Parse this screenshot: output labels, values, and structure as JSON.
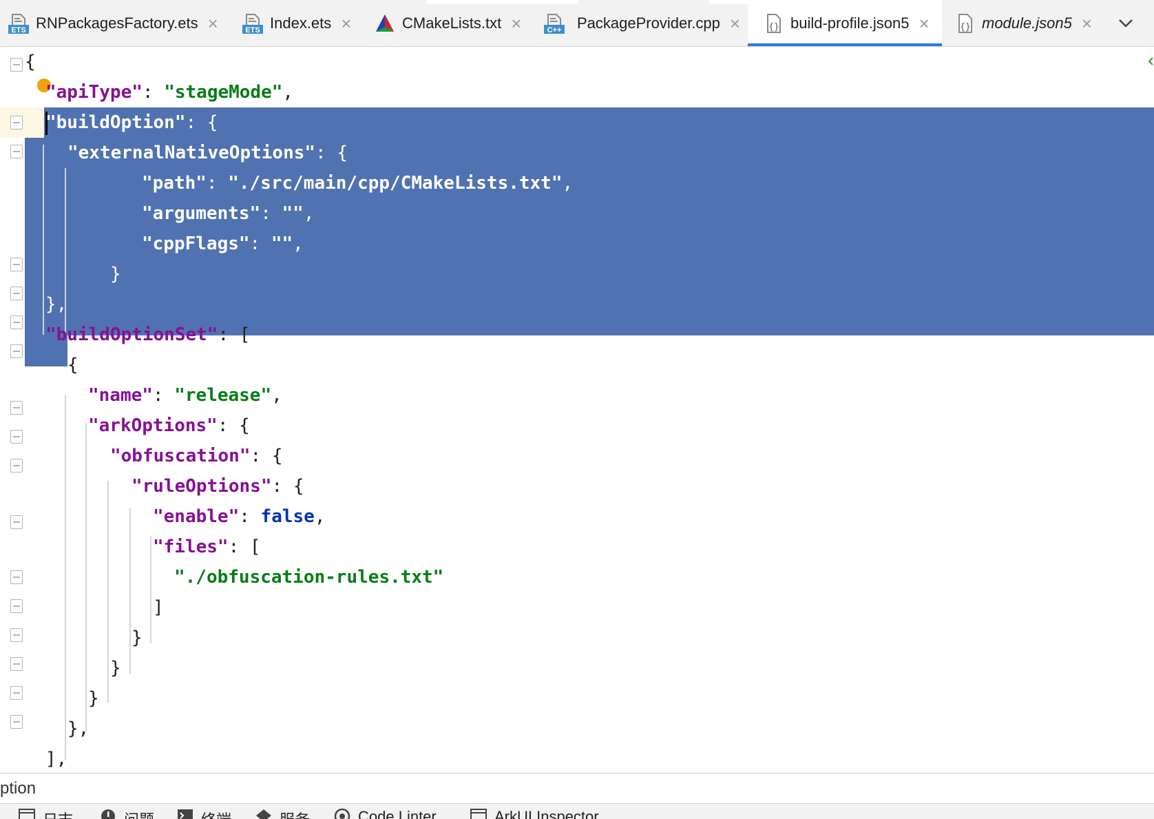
{
  "tabs": [
    {
      "label": "RNPackagesFactory.ets",
      "icon": "ets-file-icon",
      "icon_text": "ETS",
      "active": false
    },
    {
      "label": "Index.ets",
      "icon": "ets-file-icon",
      "icon_text": "ETS",
      "active": false
    },
    {
      "label": "CMakeLists.txt",
      "icon": "cmake-file-icon",
      "active": false
    },
    {
      "label": "PackageProvider.cpp",
      "icon": "cpp-file-icon",
      "icon_text": "C++",
      "active": false
    },
    {
      "label": "build-profile.json5",
      "icon": "json5-file-icon",
      "active": true
    },
    {
      "label": "module.json5",
      "icon": "json5-file-icon",
      "active": false,
      "italic": true
    }
  ],
  "colors": {
    "key": "#871094",
    "string": "#067d17",
    "boolean": "#0033b3",
    "selection": "#5072b0",
    "active_tab_underline": "#2d7bd8",
    "current_line": "#fcf6e4",
    "intention_bulb": "#f0a30a"
  },
  "editor": {
    "file": "build-profile.json5",
    "lines": [
      "{",
      "\"apiType\": \"stageMode\",",
      "\"buildOption\": {",
      "\"externalNativeOptions\": {",
      "\"path\": \"./src/main/cpp/CMakeLists.txt\",",
      "\"arguments\": \"\",",
      "\"cppFlags\": \"\",",
      "}",
      "},",
      "\"buildOptionSet\": [",
      "{",
      "\"name\": \"release\",",
      "\"arkOptions\": {",
      "\"obfuscation\": {",
      "\"ruleOptions\": {",
      "\"enable\": false,",
      "\"files\": [",
      "\"./obfuscation-rules.txt\"",
      "]",
      "}",
      "}",
      "}",
      "},",
      "],"
    ]
  },
  "breadcrumb": "ption",
  "bottom_tools": [
    {
      "label": "日志",
      "icon": "log-icon"
    },
    {
      "label": "问题",
      "icon": "problems-icon"
    },
    {
      "label": "终端",
      "icon": "terminal-icon"
    },
    {
      "label": "服务",
      "icon": "services-icon"
    },
    {
      "label": "Code Linter",
      "icon": "code-linter-icon"
    },
    {
      "label": "ArkUI Inspector",
      "icon": "arkui-inspector-icon"
    }
  ]
}
